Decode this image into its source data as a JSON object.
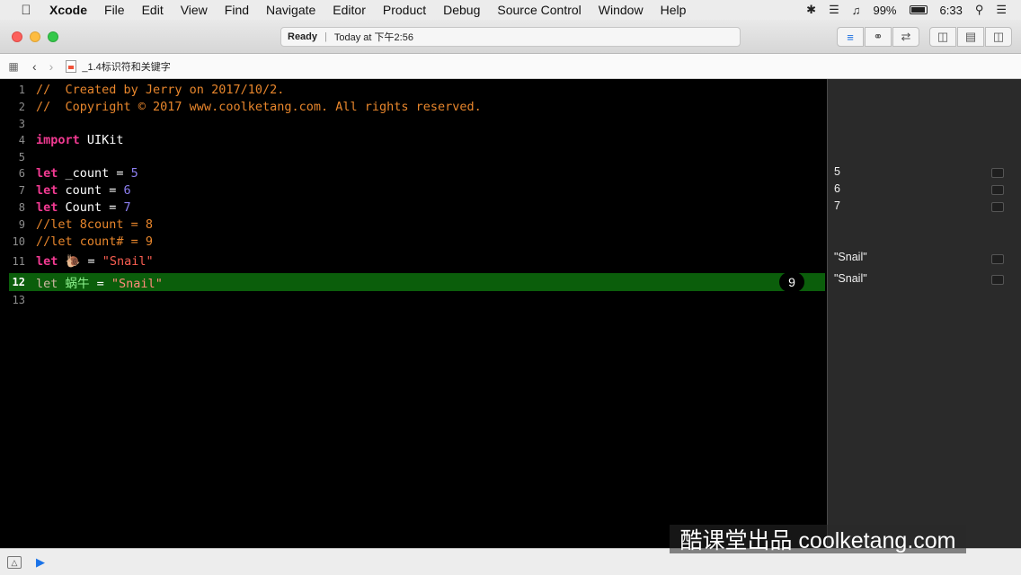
{
  "menubar": {
    "items": [
      "Xcode",
      "File",
      "Edit",
      "View",
      "Find",
      "Navigate",
      "Editor",
      "Product",
      "Debug",
      "Source Control",
      "Window",
      "Help"
    ],
    "battery": "99%",
    "time": "6:33"
  },
  "toolbar": {
    "status": "Ready",
    "timestamp": "Today at 下午2:56"
  },
  "jumpbar": {
    "filename": "_1.4标识符和关键字"
  },
  "editor": {
    "line_numbers": [
      "1",
      "2",
      "3",
      "4",
      "5",
      "6",
      "7",
      "8",
      "9",
      "10",
      "11",
      "12",
      "13"
    ],
    "lines": {
      "l1": "//  Created by Jerry on 2017/10/2.",
      "l2": "//  Copyright © 2017 www.coolketang.com. All rights reserved.",
      "l4_kw": "import",
      "l4_rest": " UIKit",
      "l6_kw": "let",
      "l6_id": " _count = ",
      "l6_num": "5",
      "l7_kw": "let",
      "l7_id": " count = ",
      "l7_num": "6",
      "l8_kw": "let",
      "l8_id": " Count = ",
      "l8_num": "7",
      "l9": "//let 8count = 8",
      "l10": "//let count# = 9",
      "l11_kw": "let",
      "l11_id": " 🐌 = ",
      "l11_str": "\"Snail\"",
      "l12_kw": "let",
      "l12_id": " 蜗牛",
      "l12_eq": " = ",
      "l12_str": "\"Snail\""
    },
    "line_badge": "9"
  },
  "results": {
    "r6": "5",
    "r7": "6",
    "r8": "7",
    "r11": "\"Snail\"",
    "r12": "\"Snail\""
  },
  "watermark": "酷课堂出品 coolketang.com",
  "colors": {
    "keyword": "#f23a92",
    "comment": "#e8862c",
    "number": "#8c7ff0",
    "string": "#fc5f52",
    "highlight_line": "#0b5e0b"
  }
}
